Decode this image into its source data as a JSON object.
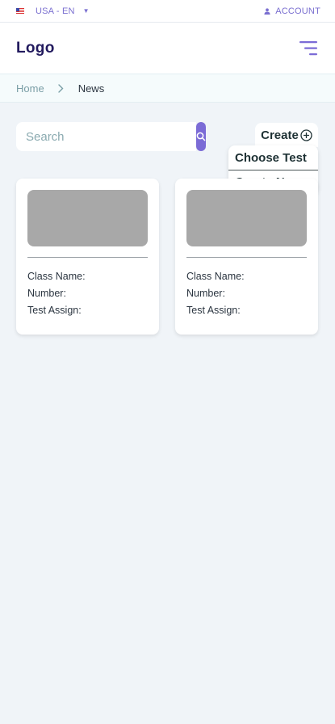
{
  "topbar": {
    "locale_label": "USA - EN",
    "flag_icon": "us-flag-icon",
    "locale_caret_icon": "caret-down-icon",
    "account_icon": "user-icon",
    "account_label": "ACCOUNT"
  },
  "header": {
    "logo_text": "Logo",
    "menu_icon": "menu-icon"
  },
  "breadcrumb": {
    "items": [
      "Home",
      "News"
    ],
    "separator_icon": "chevron-right-icon"
  },
  "search": {
    "placeholder": "Search",
    "value": "",
    "button_icon": "search-icon"
  },
  "create": {
    "label": "Create",
    "icon": "plus-circle-icon",
    "menu_items": [
      "Choose Test",
      "Create New"
    ]
  },
  "cards": [
    {
      "class_name_label": "Class Name:",
      "number_label": "Number:",
      "test_assign_label": "Test Assign:"
    },
    {
      "class_name_label": "Class Name:",
      "number_label": "Number:",
      "test_assign_label": "Test Assign:"
    }
  ],
  "colors": {
    "accent": "#7b6bd6",
    "logo": "#221a5e",
    "background": "#f0f4f8",
    "image_placeholder": "#a8a8a8"
  }
}
